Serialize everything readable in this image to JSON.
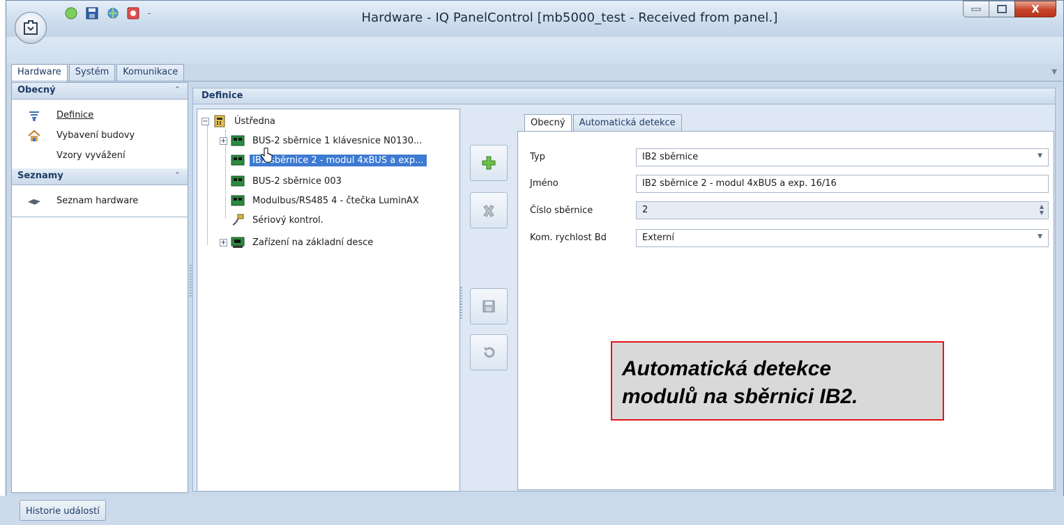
{
  "window": {
    "title": "Hardware - IQ PanelControl [mb5000_test - Received from panel.]",
    "controls": {
      "minimize": "–",
      "maximize": "□",
      "close": "X"
    }
  },
  "qat": {
    "icons": [
      "green-orb-icon",
      "save-icon",
      "globe-icon",
      "red-gear-icon"
    ],
    "dropdown": "-"
  },
  "main_tabs": [
    "Hardware",
    "Systém",
    "Komunikace"
  ],
  "nav": {
    "groups": [
      {
        "title": "Obecný",
        "items": [
          {
            "label": "Definice",
            "icon": "definition-icon"
          },
          {
            "label": "Vybavení budovy",
            "icon": "building-icon"
          },
          {
            "label": "Vzory vyvážení",
            "icon": ""
          }
        ]
      },
      {
        "title": "Seznamy",
        "items": [
          {
            "label": "Seznam hardware",
            "icon": "hardware-icon"
          }
        ]
      }
    ],
    "collapse_glyph": "⌃"
  },
  "content_header": "Definice",
  "tree": {
    "root": "Ústředna",
    "children": [
      {
        "label": "BUS-2 sběrnice 1 klávesnice N0130...",
        "expandable": true
      },
      {
        "label": "IB2 sběrnice 2 - modul 4xBUS a exp...",
        "selected": true
      },
      {
        "label": "BUS-2 sběrnice 003"
      },
      {
        "label": "Modulbus/RS485  4 - čtečka LuminAX"
      },
      {
        "label": "Sériový kontrol."
      },
      {
        "label": "Zařízení na základní desce",
        "expandable": true
      }
    ]
  },
  "actions": [
    "add-icon",
    "delete-icon",
    "save-icon",
    "undo-icon"
  ],
  "details": {
    "tabs": [
      "Obecný",
      "Automatická detekce"
    ],
    "fields": [
      {
        "label": "Typ",
        "value": "IB2 sběrnice",
        "kind": "dropdown"
      },
      {
        "label": "Jméno",
        "value": "IB2 sběrnice 2 - modul 4xBUS a exp. 16/16",
        "kind": "text"
      },
      {
        "label": "Číslo sběrnice",
        "value": "2",
        "kind": "spinner"
      },
      {
        "label": "Kom. rychlost Bd",
        "value": "Externí",
        "kind": "dropdown"
      }
    ]
  },
  "callout": {
    "line1": "Automatická detekce",
    "line2": "modulů na sběrnici IB2."
  },
  "bottom_tab": "Historie událostí",
  "colors": {
    "selection": "#3d7ad1",
    "callout_border": "#e0141a",
    "callout_bg": "#d9d9d9",
    "frame": "#c9d9ea"
  }
}
